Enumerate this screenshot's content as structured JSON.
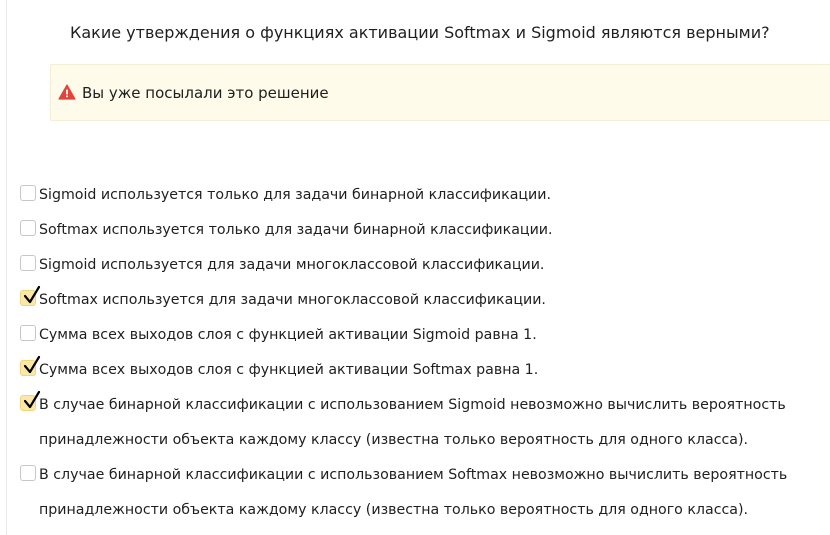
{
  "question": {
    "text": "Какие утверждения о функциях активации Softmax и Sigmoid являются верными?"
  },
  "warning": {
    "icon": "warning-triangle-icon",
    "text": "Вы уже посылали это решение",
    "icon_color": "#e0443a",
    "background": "#fefbea"
  },
  "options": [
    {
      "label": "Sigmoid используется только для задачи бинарной классификации.",
      "checked": false
    },
    {
      "label": "Softmax используется только для задачи бинарной классификации.",
      "checked": false
    },
    {
      "label": "Sigmoid используется для задачи многоклассовой классификации.",
      "checked": false
    },
    {
      "label": "Softmax используется для задачи многоклассовой классификации.",
      "checked": true
    },
    {
      "label": "Сумма всех выходов слоя с функцией активации Sigmoid равна 1.",
      "checked": false
    },
    {
      "label": "Сумма всех выходов слоя с функцией активации Softmax равна 1.",
      "checked": true
    },
    {
      "label": "В случае бинарной классификации с использованием Sigmoid невозможно вычислить вероятность принадлежности объекта каждому классу (известна только вероятность для одного класса).",
      "checked": true
    },
    {
      "label": "В случае бинарной классификации с использованием Softmax невозможно вычислить вероятность принадлежности объекта каждому классу (известна только вероятность для одного класса).",
      "checked": false
    }
  ],
  "colors": {
    "checked_fill": "#fbe8a8",
    "checkmark": "#000000"
  }
}
